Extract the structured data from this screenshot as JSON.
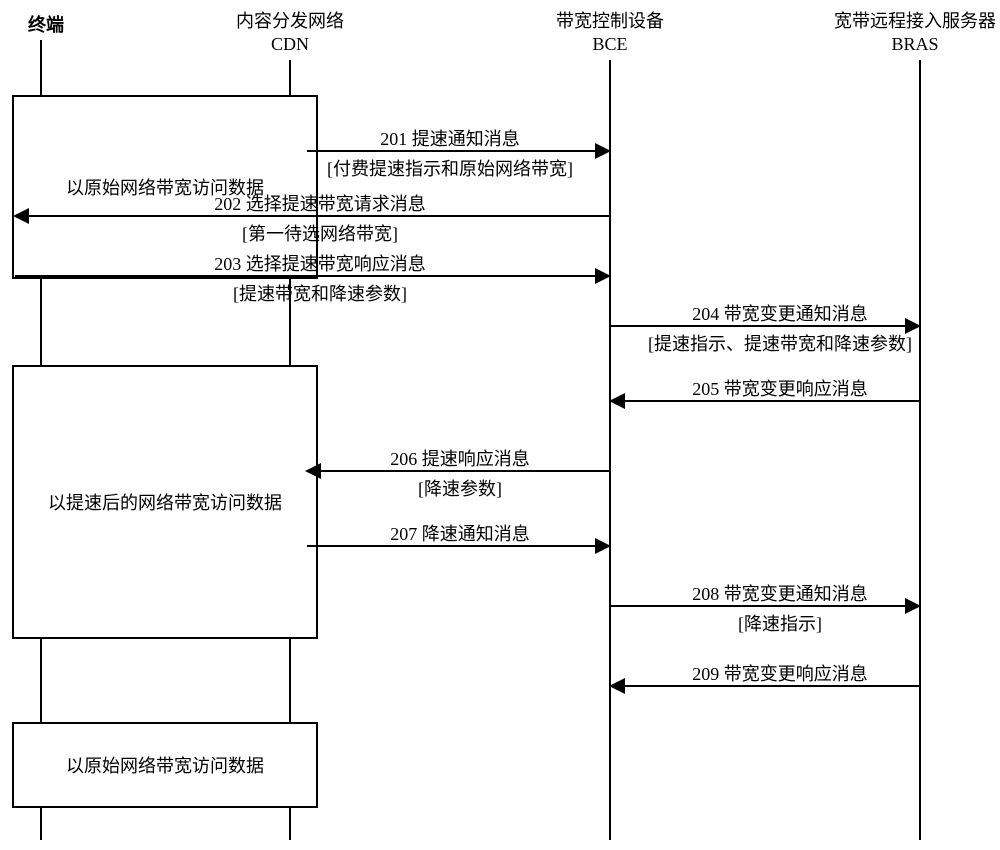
{
  "actors": {
    "terminal": {
      "label": "终端"
    },
    "cdn": {
      "line1": "内容分发网络",
      "line2": "CDN"
    },
    "bce": {
      "line1": "带宽控制设备",
      "line2": "BCE"
    },
    "bras": {
      "line1": "宽带远程接入服务器",
      "line2": "BRAS"
    }
  },
  "boxes": {
    "b1": "以原始网络带宽访问数据",
    "b2": "以提速后的网络带宽访问数据",
    "b3": "以原始网络带宽访问数据"
  },
  "messages": {
    "m201": {
      "label": "201 提速通知消息",
      "sub": "[付费提速指示和原始网络带宽]"
    },
    "m202": {
      "label": "202 选择提速带宽请求消息",
      "sub": "[第一待选网络带宽]"
    },
    "m203": {
      "label": "203 选择提速带宽响应消息",
      "sub": "[提速带宽和降速参数]"
    },
    "m204": {
      "label": "204 带宽变更通知消息",
      "sub": "[提速指示、提速带宽和降速参数]"
    },
    "m205": {
      "label": "205 带宽变更响应消息"
    },
    "m206": {
      "label": "206 提速响应消息",
      "sub": "[降速参数]"
    },
    "m207": {
      "label": "207 降速通知消息"
    },
    "m208": {
      "label": "208 带宽变更通知消息",
      "sub": "[降速指示]"
    },
    "m209": {
      "label": "209 带宽变更响应消息"
    }
  }
}
